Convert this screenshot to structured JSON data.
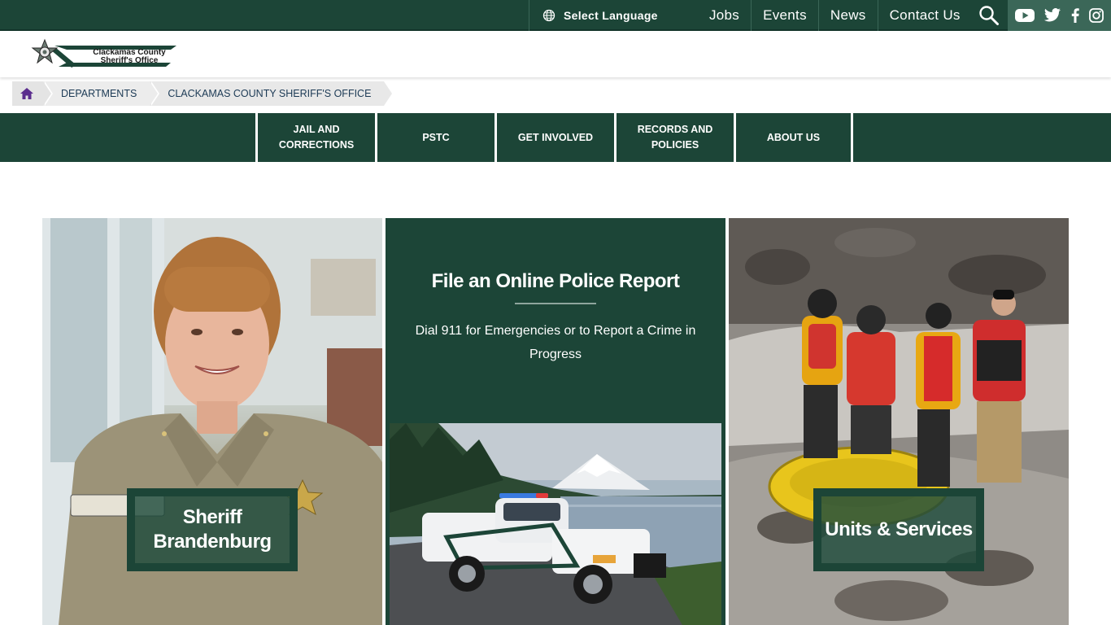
{
  "topbar": {
    "language_label": "Select Language",
    "links": [
      "Jobs",
      "Events",
      "News",
      "Contact Us"
    ]
  },
  "social": [
    "youtube-icon",
    "twitter-icon",
    "facebook-icon",
    "instagram-icon"
  ],
  "logo": {
    "line1": "Clackamas County",
    "line2": "Sheriff's Office"
  },
  "breadcrumb": {
    "items": [
      "DEPARTMENTS",
      "CLACKAMAS COUNTY SHERIFF'S OFFICE"
    ]
  },
  "nav": {
    "items": [
      "JAIL AND CORRECTIONS",
      "PSTC",
      "GET INVOLVED",
      "RECORDS AND POLICIES",
      "ABOUT US"
    ]
  },
  "tiles": {
    "sheriff": "Sheriff Brandenburg",
    "report_title": "File an Online Police Report",
    "report_sub": "Dial 911 for Emergencies or to Report a Crime in Progress",
    "units": "Units & Services"
  },
  "colors": {
    "brand_green": "#1c4537",
    "social_bg": "#3b6758",
    "home_icon": "#5b2d8e"
  }
}
